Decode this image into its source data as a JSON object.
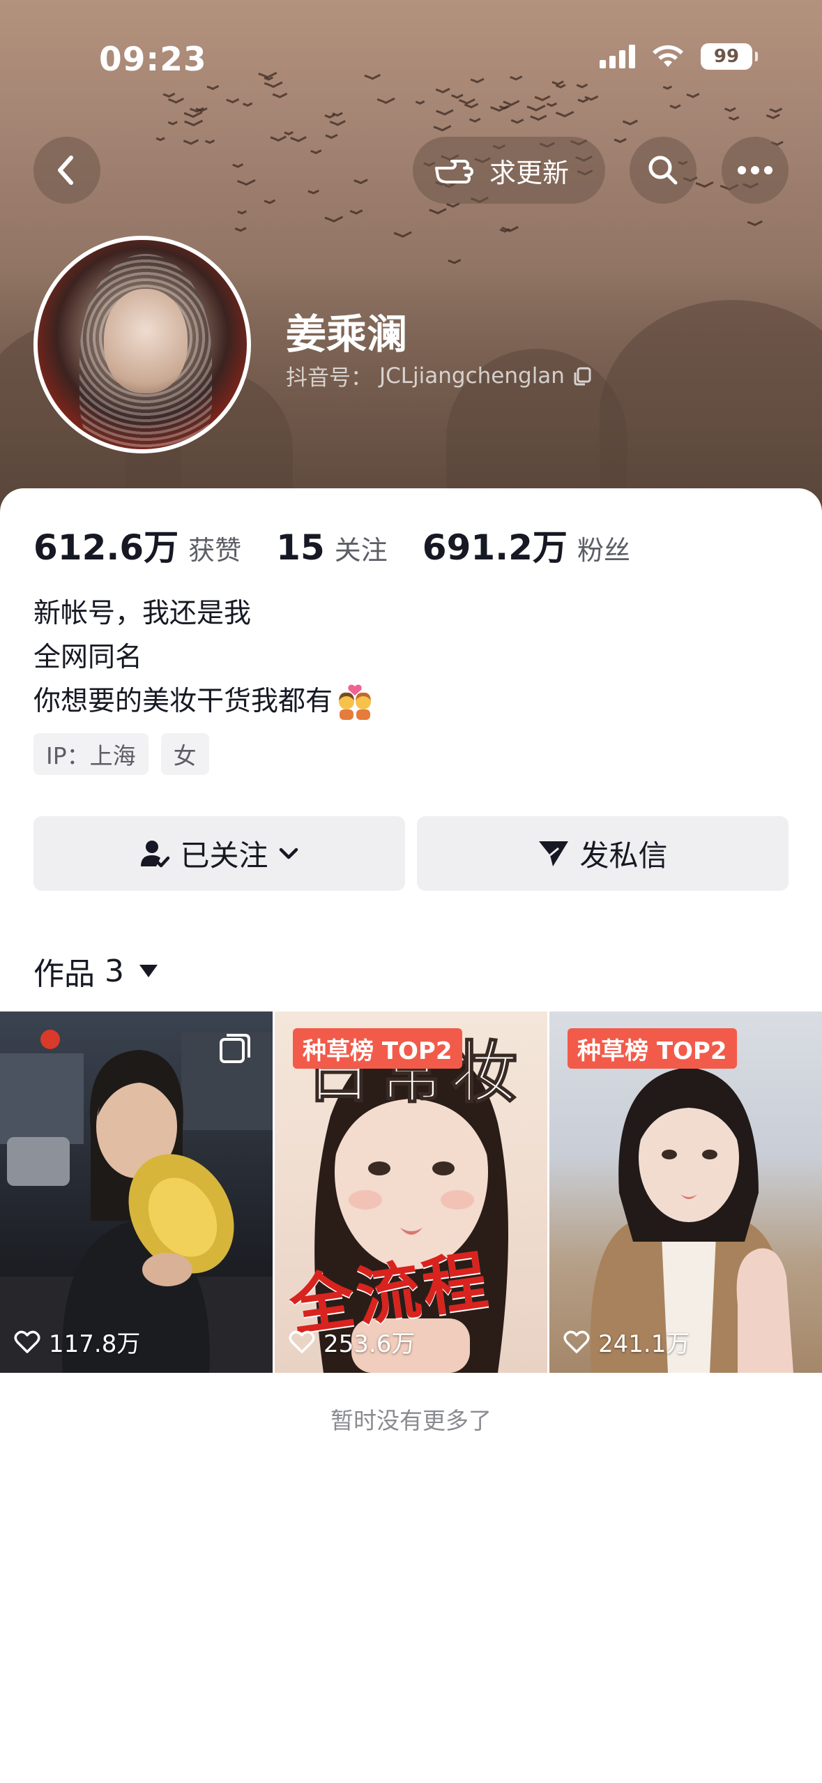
{
  "status_bar": {
    "time": "09:23",
    "battery": "99"
  },
  "nav": {
    "back_icon": "chevron-left-icon",
    "request_update_label": "求更新",
    "search_icon": "search-icon",
    "more_icon": "more-icon"
  },
  "profile": {
    "name": "姜乘澜",
    "douyin_id_label": "抖音号：",
    "douyin_id": "JCLjiangchenglan",
    "stats": [
      {
        "value": "612.6万",
        "label": "获赞"
      },
      {
        "value": "15",
        "label": "关注"
      },
      {
        "value": "691.2万",
        "label": "粉丝"
      }
    ],
    "bio": [
      "新帐号，我还是我",
      "全网同名",
      "你想要的美妆干货我都有"
    ],
    "tags": [
      "IP：上海",
      "女"
    ]
  },
  "actions": {
    "following_label": "已关注",
    "message_label": "发私信"
  },
  "works": {
    "label": "作品",
    "count": "3",
    "items": [
      {
        "likes": "117.8万"
      },
      {
        "likes": "253.6万",
        "badge": "种草榜 TOP2",
        "cover_top": "日常妆",
        "cover_bottom": "全流程"
      },
      {
        "likes": "241.1万",
        "badge": "种草榜 TOP2"
      }
    ],
    "end_note": "暂时没有更多了"
  },
  "colors": {
    "hero_bg": "#a08070",
    "badge_red": "#f25b4a",
    "button_bg": "#efeff1",
    "text_primary": "#161823",
    "text_secondary": "#5c5d66"
  }
}
